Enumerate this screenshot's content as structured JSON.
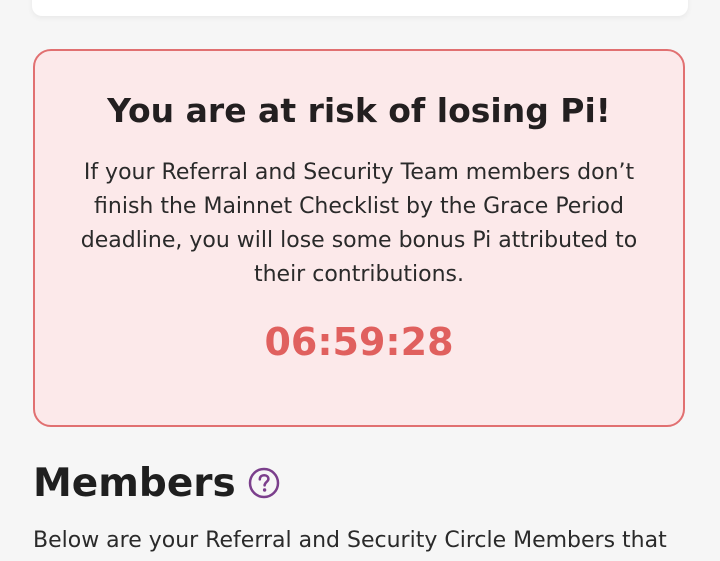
{
  "risk_card": {
    "title": "You are at risk of losing Pi!",
    "body": "If your Referral and Security Team members don’t finish the Mainnet Checklist by the Grace Period deadline, you will lose some bonus Pi attributed to their contributions.",
    "countdown": "06:59:28"
  },
  "members": {
    "title": "Members",
    "help_icon": "question-circle-icon",
    "description": "Below are your Referral and Security Circle Members that"
  },
  "colors": {
    "alert_bg": "#fce9ea",
    "alert_border": "#e17071",
    "countdown": "#e0605e",
    "help_icon": "#7b3f8c"
  }
}
